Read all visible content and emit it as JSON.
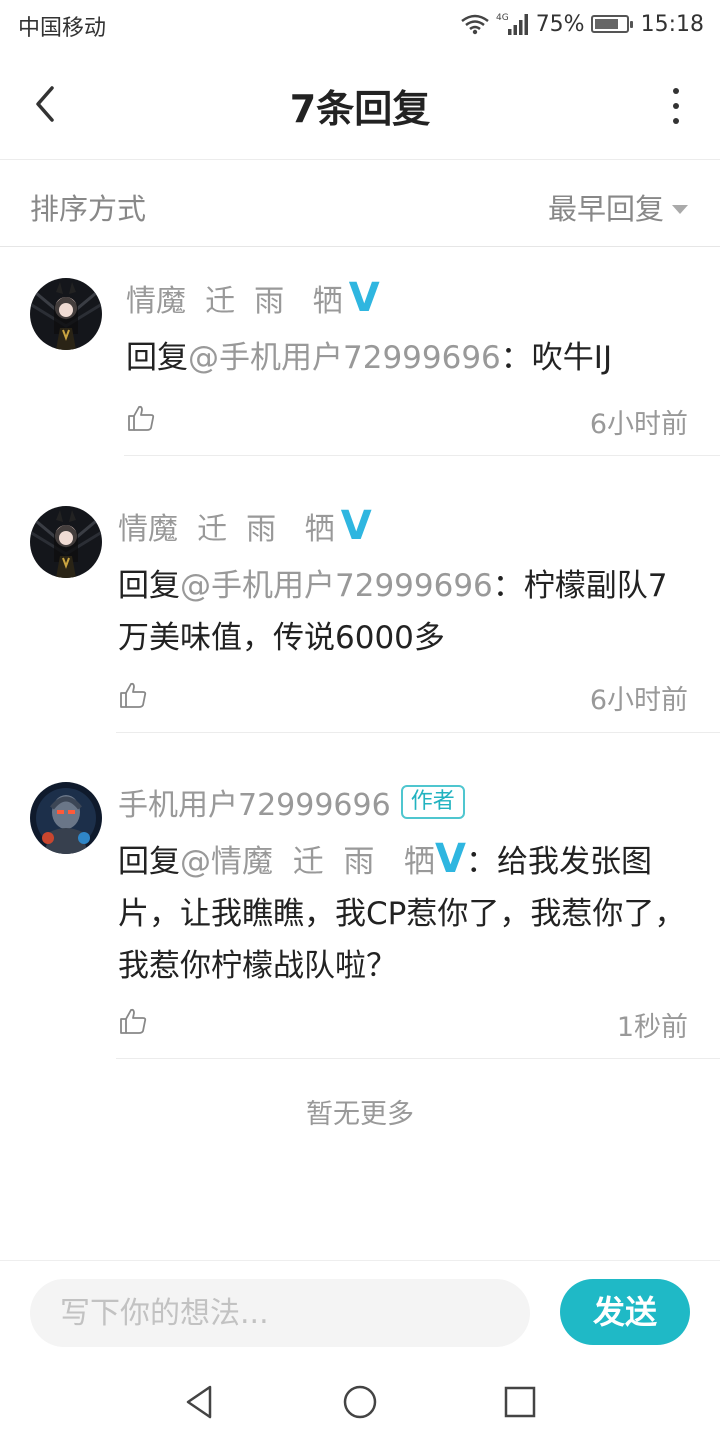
{
  "status_bar": {
    "carrier": "中国移动",
    "network": "4G",
    "battery_percent": "75%",
    "battery_level": 0.75,
    "time": "15:18"
  },
  "header": {
    "title": "7条回复"
  },
  "sort": {
    "label": "排序方式",
    "selected": "最早回复"
  },
  "comments": [
    {
      "author": "情魔  迁  雨   牺",
      "verified": "V",
      "reply_prefix": "回复",
      "mention": "@手机用户72999696",
      "separator": "：",
      "text": "吹牛IJ",
      "time": "6小时前"
    },
    {
      "author": "情魔  迁  雨   牺",
      "verified": "V",
      "reply_prefix": "回复",
      "mention": "@手机用户72999696",
      "separator": "：",
      "text": "柠檬副队7万美味值，传说6000多",
      "time": "6小时前"
    },
    {
      "author": "手机用户72999696",
      "author_badge": "作者",
      "reply_prefix": "回复",
      "mention": "@情魔  迁  雨   牺",
      "mention_verified": "V",
      "separator": "：",
      "text": "给我发张图片，让我瞧瞧，我CP惹你了，我惹你了，我惹你柠檬战队啦？",
      "time": "1秒前"
    }
  ],
  "footer_note": "暂无更多",
  "input": {
    "placeholder": "写下你的想法...",
    "value": "",
    "send_label": "发送"
  },
  "colors": {
    "accent": "#1fb9c6",
    "verified": "#2fb6e0",
    "muted_text": "#999999"
  }
}
